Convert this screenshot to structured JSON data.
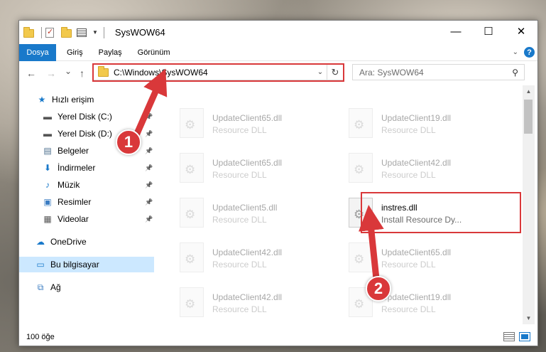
{
  "window": {
    "title": "SysWOW64",
    "controls": {
      "minimize": "—",
      "maximize": "☐",
      "close": "✕"
    }
  },
  "ribbon": {
    "tabs": [
      "Dosya",
      "Giriş",
      "Paylaş",
      "Görünüm"
    ],
    "help": "?"
  },
  "navigation": {
    "back": "←",
    "forward": "→",
    "recent": "⌄",
    "up": "↑",
    "address": "C:\\Windows\\SysWOW64",
    "refresh": "↻",
    "search_placeholder": "Ara: SysWOW64"
  },
  "sidebar": {
    "items": [
      {
        "label": "Hızlı erişim",
        "icon": "star-icon",
        "glyph": "★",
        "color": "#1979ca"
      },
      {
        "label": "Yerel Disk (C:)",
        "icon": "drive-icon",
        "glyph": "▬",
        "color": "#555555"
      },
      {
        "label": "Yerel Disk (D:)",
        "icon": "drive-icon",
        "glyph": "▬",
        "color": "#555555"
      },
      {
        "label": "Belgeler",
        "icon": "documents-icon",
        "glyph": "▤",
        "color": "#4a6d8c"
      },
      {
        "label": "İndirmeler",
        "icon": "downloads-icon",
        "glyph": "⬇",
        "color": "#1979ca"
      },
      {
        "label": "Müzik",
        "icon": "music-icon",
        "glyph": "♪",
        "color": "#1979ca"
      },
      {
        "label": "Resimler",
        "icon": "pictures-icon",
        "glyph": "▣",
        "color": "#3a7cc2"
      },
      {
        "label": "Videolar",
        "icon": "videos-icon",
        "glyph": "▦",
        "color": "#555555"
      },
      {
        "label": "OneDrive",
        "icon": "cloud-icon",
        "glyph": "☁",
        "color": "#1979ca"
      },
      {
        "label": "Bu bilgisayar",
        "icon": "computer-icon",
        "glyph": "▭",
        "color": "#1979ca"
      },
      {
        "label": "Ağ",
        "icon": "network-icon",
        "glyph": "⧉",
        "color": "#3a7cc2"
      }
    ]
  },
  "files": [
    {
      "name": "UpdateClient65.dll",
      "desc": "Resource DLL"
    },
    {
      "name": "UpdateClient19.dll",
      "desc": "Resource DLL"
    },
    {
      "name": "UpdateClient65.dll",
      "desc": "Resource DLL"
    },
    {
      "name": "UpdateClient42.dll",
      "desc": "Resource DLL"
    },
    {
      "name": "UpdateClient5.dll",
      "desc": "Resource DLL"
    },
    {
      "name": "instres.dll",
      "desc": "Install Resource Dy..."
    },
    {
      "name": "UpdateClient42.dll",
      "desc": "Resource DLL"
    },
    {
      "name": "UpdateClient65.dll",
      "desc": "Resource DLL"
    },
    {
      "name": "UpdateClient42.dll",
      "desc": "Resource DLL"
    },
    {
      "name": "UpdateClient19.dll",
      "desc": "Resource DLL"
    }
  ],
  "status": {
    "item_count": "100 öğe"
  },
  "annotations": {
    "step1": "1",
    "step2": "2",
    "color": "#d9383a"
  }
}
